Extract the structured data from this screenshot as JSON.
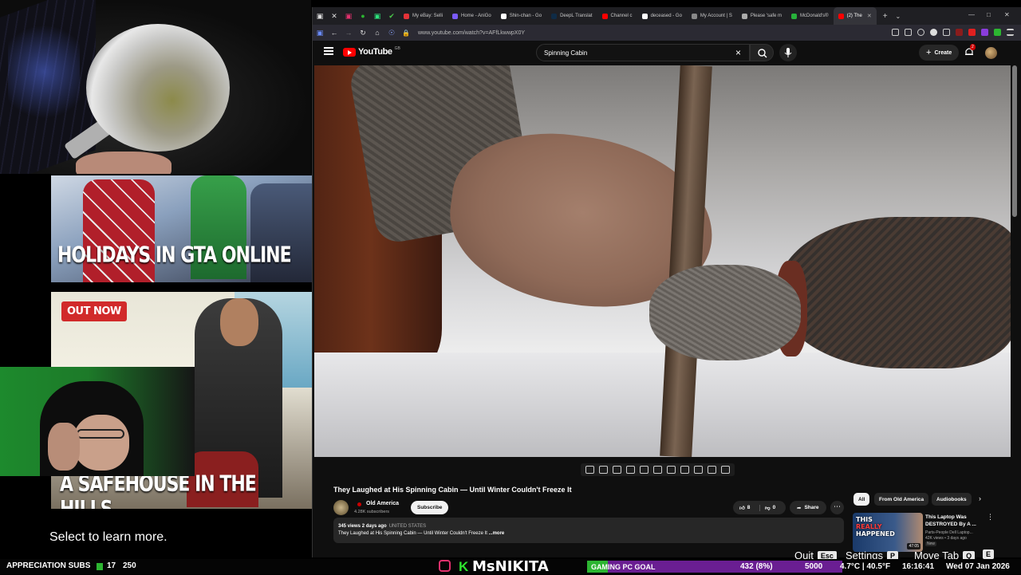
{
  "stream_overlay": {
    "promo_top_caption": "HOLIDAYS IN GTA ONLINE",
    "promo_badge": "OUT NOW",
    "promo_bottom_caption": "A SAFEHOUSE IN THE HILLS",
    "select_prompt": "Select to learn more."
  },
  "browser": {
    "tabs": [
      {
        "label": "My eBay: Selli",
        "icon": "ebay-icon",
        "color": "#e53238"
      },
      {
        "label": "Home - AniGo",
        "icon": "anigo-icon",
        "color": "#7a5af8"
      },
      {
        "label": "Shin-chan - Go",
        "icon": "google-icon",
        "color": "#ffffff"
      },
      {
        "label": "DeepL Translat",
        "icon": "deepl-icon",
        "color": "#0f2b46"
      },
      {
        "label": "Channel c",
        "icon": "youtube-icon",
        "color": "#ff0000"
      },
      {
        "label": "deceased - Go",
        "icon": "google-icon",
        "color": "#ffffff"
      },
      {
        "label": "My Account | S",
        "icon": "account-icon",
        "color": "#888888"
      },
      {
        "label": "Please 'safe m",
        "icon": "page-icon",
        "color": "#aaaaaa"
      },
      {
        "label": "McDonald's®",
        "icon": "mcdonalds-icon",
        "color": "#27b13a"
      },
      {
        "label": "(2) The",
        "icon": "youtube-icon",
        "color": "#ff0000",
        "active": true
      }
    ],
    "url": "www.youtube.com/watch?v=AFfLkwwpX0Y",
    "new_tab": "+",
    "tab_list": "⌄"
  },
  "youtube": {
    "logo_text": "YouTube",
    "region": "GB",
    "search_query": "Spinning Cabin",
    "create_label": "Create",
    "notifications_count": "2",
    "video_title": "They Laughed at His Spinning Cabin — Until Winter Couldn't Freeze It",
    "channel_name": "Old America",
    "subscribers": "4.28K subscribers",
    "subscribe_label": "Subscribe",
    "likes": "8",
    "dislikes": "0",
    "share_label": "Share",
    "views_and_date": "345 views  2 days ago",
    "country": "UNITED STATES",
    "description": "They Laughed at His Spinning Cabin — Until Winter Couldn't Freeze It ",
    "more_label": "...more",
    "chips": [
      "All",
      "From Old America",
      "Audiobooks"
    ],
    "recommendation": {
      "thumb_line1": "THIS",
      "thumb_line2": "REALLY",
      "thumb_line3": "HAPPENED",
      "duration": "47:05",
      "title": "This Laptop Was DESTROYED By A ...",
      "channel": "Parts-People Dell Laptop...",
      "views": "42K views • 3 days ago",
      "badge": "New"
    }
  },
  "hotkeys": [
    {
      "label": "Quit",
      "key": "Esc"
    },
    {
      "label": "Settings",
      "key": "P"
    },
    {
      "label": "Move Tab",
      "key": "Q"
    },
    {
      "label": "",
      "key": "E"
    }
  ],
  "status_bar": {
    "subs_label": "APPRECIATION SUBS",
    "subs_count": "17",
    "subs_goal": "250",
    "streamer_name": "MsNIKITA",
    "logo_letter": "K",
    "goal_label": "GAMING PC GOAL",
    "goal_progress": "432 (8%)",
    "goal_fraction": 0.08,
    "goal_target": "5000",
    "weather": "4.7°C | 40.5°F",
    "time": "16:16:41",
    "date": "Wed 07 Jan 2026"
  }
}
